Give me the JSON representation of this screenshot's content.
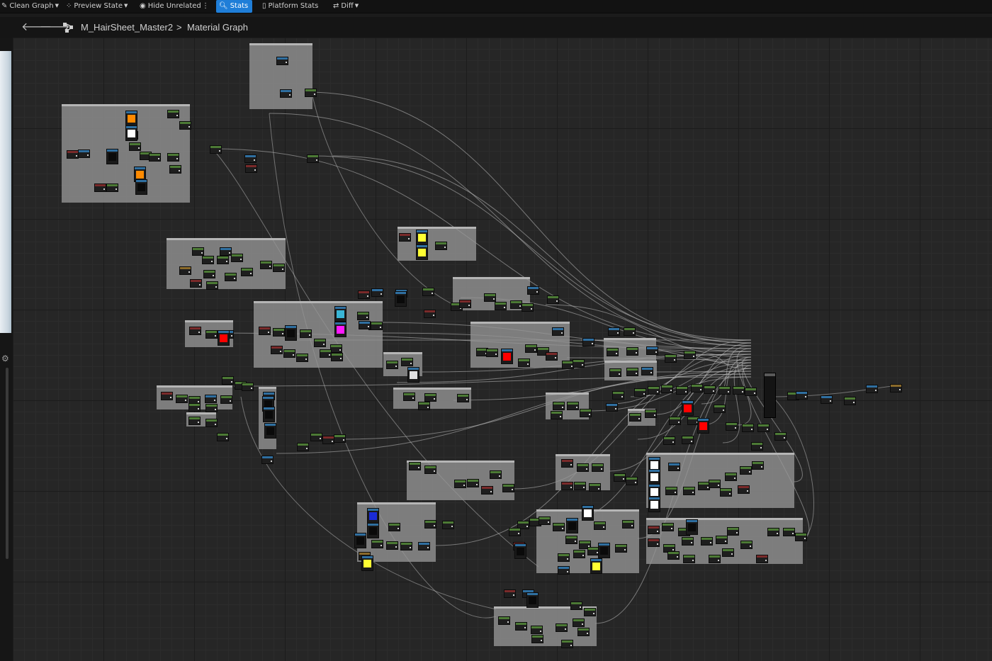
{
  "toolbar": {
    "clean_graph": "Clean Graph",
    "preview_state": "Preview State",
    "hide_unrelated": "Hide Unrelated",
    "stats": "Stats",
    "platform_stats": "Platform Stats",
    "diff": "Diff",
    "stats_color": "#1f7ed8"
  },
  "breadcrumb": {
    "asset": "M_HairSheet_Master2",
    "separator": ">",
    "graph": "Material Graph"
  },
  "graph": {
    "watermark": "",
    "comment_color": "#969696",
    "node_header_colors": [
      "#4c7a35",
      "#2f6fa0",
      "#7a2a2a",
      "#8a6a2a"
    ],
    "swatch_colors": [
      "#ff8a00",
      "#ffffff",
      "#39b6d6",
      "#ff19ff",
      "#ff0000",
      "#ffff33",
      "#1a2bd6",
      "#e0e0e0"
    ]
  },
  "icons": {
    "back": "arrow-left-icon",
    "forward": "arrow-right-icon",
    "graph": "graph-icon",
    "settings": "gear-icon"
  }
}
